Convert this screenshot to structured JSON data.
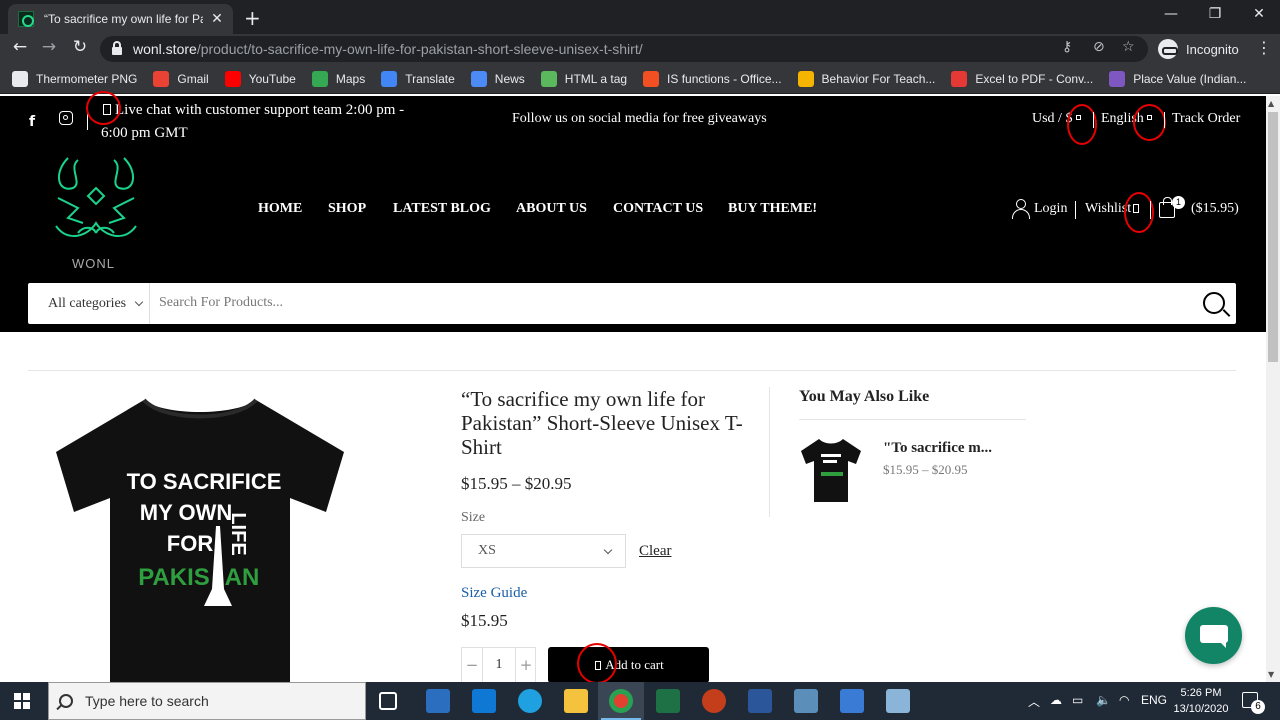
{
  "browser": {
    "tab_title": "“To sacrifice my own life for Pakis",
    "url_host": "wonl.store",
    "url_path": "/product/to-sacrifice-my-own-life-for-pakistan-short-sleeve-unisex-t-shirt/",
    "profile_label": "Incognito",
    "bookmarks": [
      {
        "label": "Thermometer PNG",
        "color": "#e8eaed"
      },
      {
        "label": "Gmail",
        "color": "#ea4335"
      },
      {
        "label": "YouTube",
        "color": "#ff0000"
      },
      {
        "label": "Maps",
        "color": "#34a853"
      },
      {
        "label": "Translate",
        "color": "#4285f4"
      },
      {
        "label": "News",
        "color": "#4c8bf5"
      },
      {
        "label": "HTML a tag",
        "color": "#5cb85c"
      },
      {
        "label": "IS functions - Office...",
        "color": "#f25022"
      },
      {
        "label": "Behavior For Teach...",
        "color": "#f4b400"
      },
      {
        "label": "Excel to PDF - Conv...",
        "color": "#e53935"
      },
      {
        "label": "Place Value (Indian...",
        "color": "#7e57c2"
      }
    ]
  },
  "site": {
    "live_chat": "Live chat with customer support team 2:00 pm - 6:00 pm GMT",
    "follow_text": "Follow us on social media for free giveaways",
    "currency": "Usd / $",
    "language": "English",
    "track_order": "Track Order",
    "logo_text": "WONL",
    "nav": [
      "HOME",
      "SHOP",
      "LATEST BLOG",
      "ABOUT US",
      "CONTACT US",
      "BUY THEME!"
    ],
    "login": "Login",
    "wishlist": "Wishlist",
    "cart_count": "1",
    "cart_total": "($15.95)",
    "category_select": "All categories",
    "search_placeholder": "Search For Products..."
  },
  "product": {
    "title": "“To sacrifice my own life for Pakistan” Short-Sleeve Unisex T-Shirt",
    "price_range": "$15.95 – $20.95",
    "size_label": "Size",
    "size_value": "XS",
    "clear": "Clear",
    "size_guide": "Size Guide",
    "variation_price": "$15.95",
    "quantity": "1",
    "add_to_cart": "Add to cart",
    "shirt_print": {
      "line1": "TO SACRIFICE",
      "line2": "MY OWN",
      "line2b": "LIFE",
      "line3": "FOR",
      "line4": "PAKIS",
      "line4b": "AN"
    }
  },
  "related": {
    "heading": "You May Also Like",
    "items": [
      {
        "title": "\"To sacrifice m...",
        "price": "$15.95 – $20.95"
      }
    ]
  },
  "taskbar": {
    "search_placeholder": "Type here to search",
    "language": "ENG",
    "time": "5:26 PM",
    "date": "13/10/2020",
    "notifications": "6"
  }
}
